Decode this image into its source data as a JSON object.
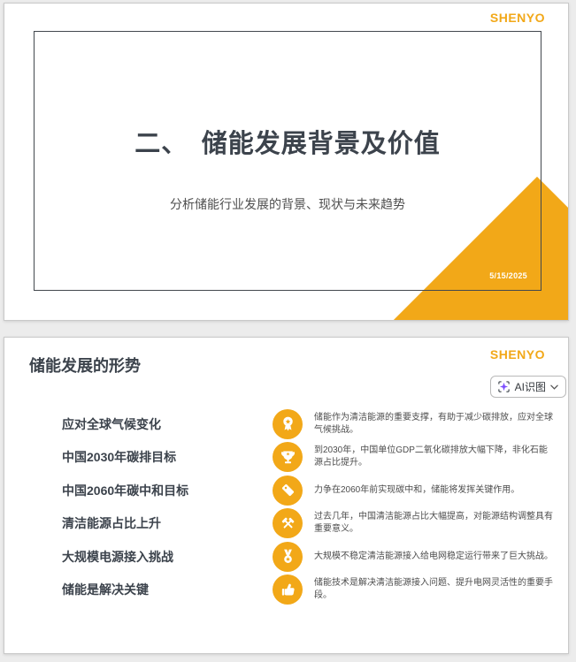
{
  "brand": "SHENYO",
  "slide1": {
    "title": "二、　储能发展背景及价值",
    "subtitle": "分析储能行业发展的背景、现状与未来趋势",
    "date": "5/15/2025"
  },
  "slide2": {
    "title": "储能发展的形势",
    "ai_button": {
      "label": "AI识图"
    },
    "rows": [
      {
        "label": "应对全球气候变化",
        "icon": "award-ribbon-icon",
        "desc": "储能作为清洁能源的重要支撑，有助于减少碳排放，应对全球气候挑战。"
      },
      {
        "label": "中国2030年碳排目标",
        "icon": "trophy-icon",
        "desc": "到2030年，中国单位GDP二氧化碳排放大幅下降，非化石能源占比提升。"
      },
      {
        "label": "中国2060年碳中和目标",
        "icon": "tag-icon",
        "desc": "力争在2060年前实现碳中和，储能将发挥关键作用。"
      },
      {
        "label": "清洁能源占比上升",
        "icon": "crossed-hammers-icon",
        "desc": "过去几年，中国清洁能源占比大幅提高，对能源结构调整具有重要意义。"
      },
      {
        "label": "大规模电源接入挑战",
        "icon": "medal-icon",
        "desc": "大规模不稳定清洁能源接入给电网稳定运行带来了巨大挑战。"
      },
      {
        "label": "储能是解决关键",
        "icon": "thumbs-up-icon",
        "desc": "储能技术是解决清洁能源接入问题、提升电网灵活性的重要手段。"
      }
    ]
  },
  "colors": {
    "accent": "#F2A818",
    "heading": "#3C434C",
    "body_text": "#4d4d4d",
    "ai_icon_purple": "#7C4DFF"
  }
}
